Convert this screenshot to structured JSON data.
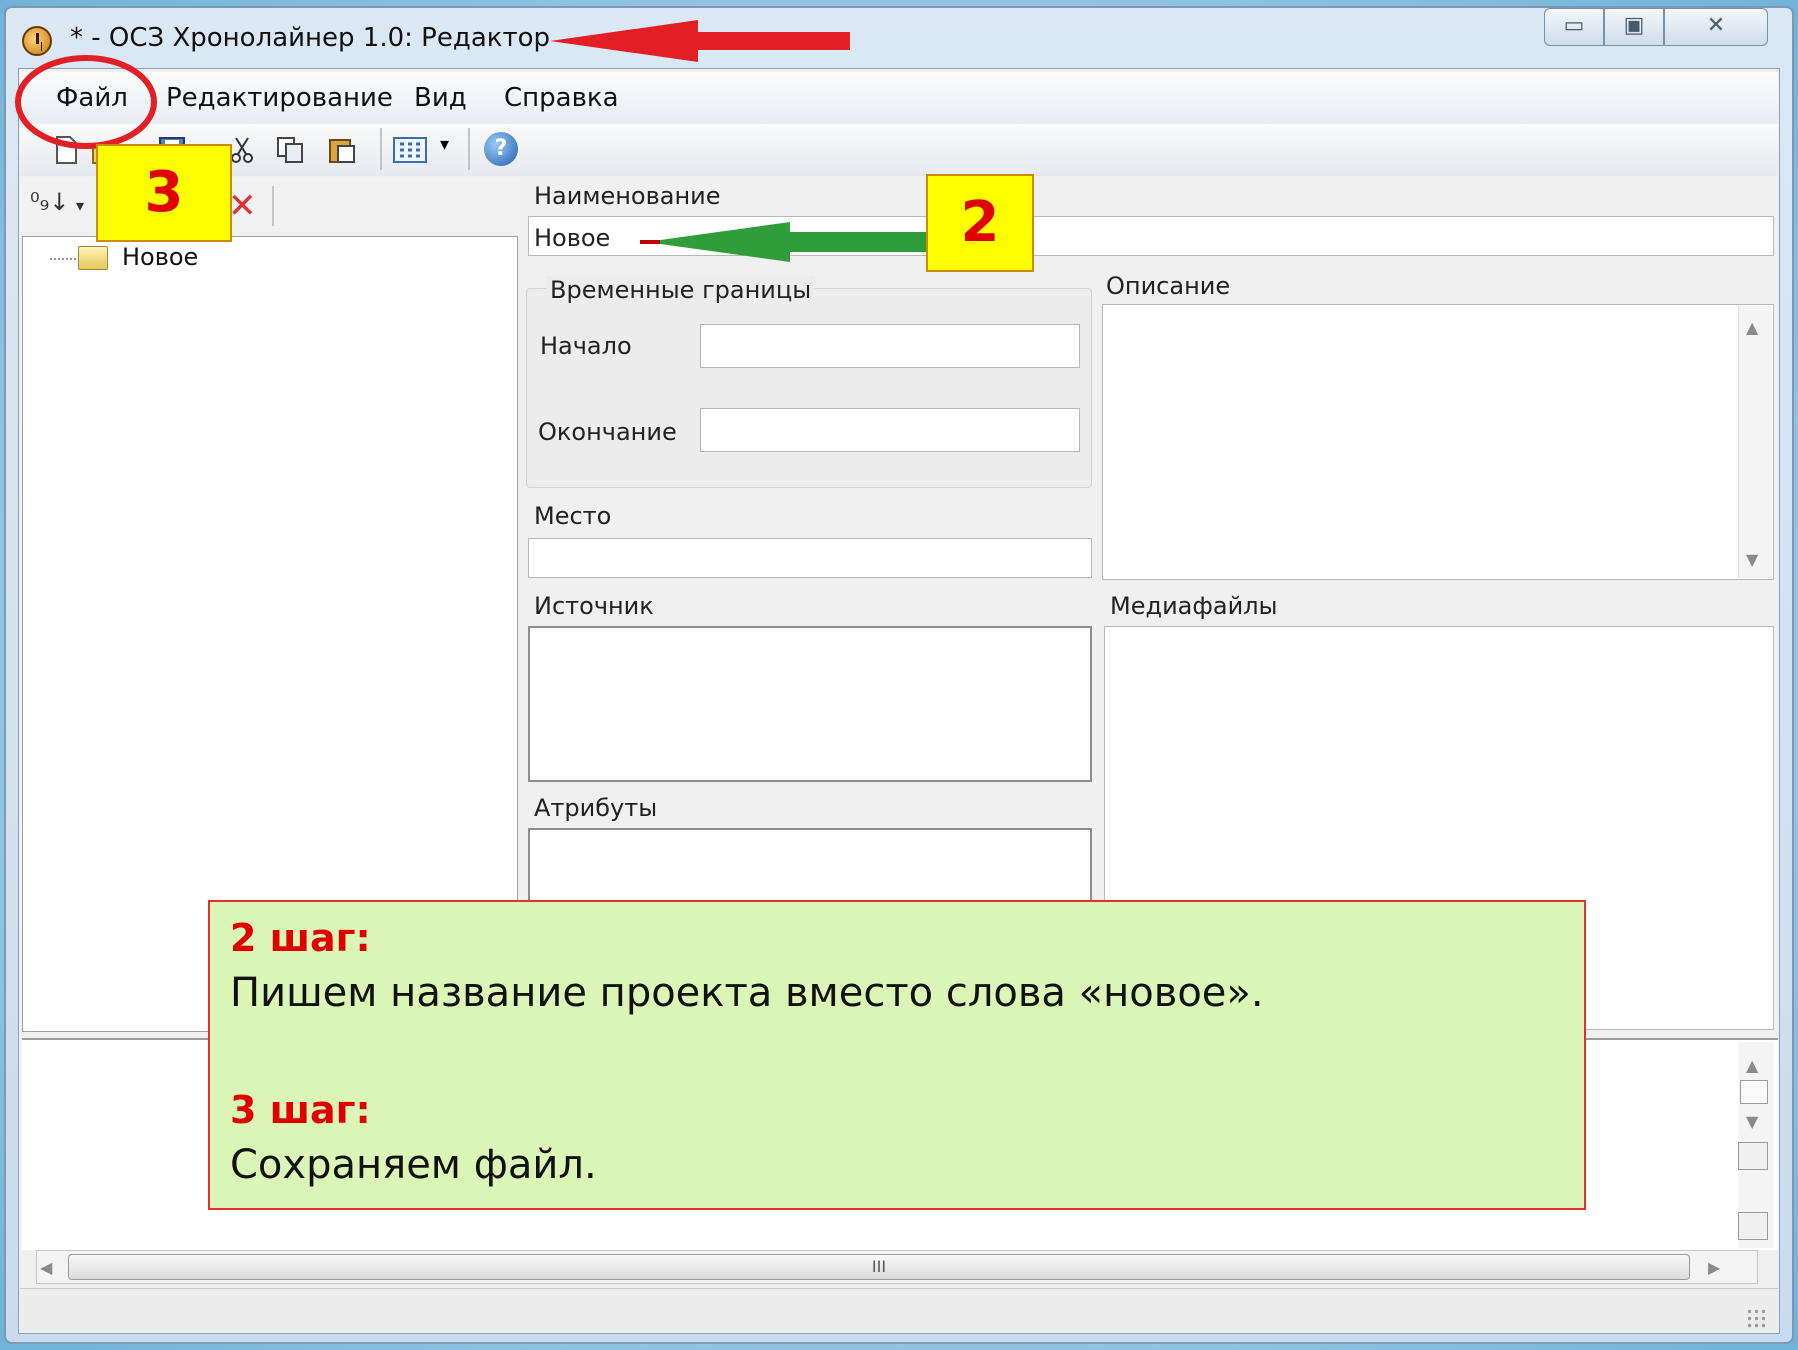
{
  "window": {
    "title": "* - ОСЗ Хронолайнер 1.0: Редактор",
    "min_glyph": "▭",
    "max_glyph": "▣",
    "close_glyph": "✕"
  },
  "menu": {
    "items": [
      "Файл",
      "Редактирование",
      "Вид",
      "Справка"
    ]
  },
  "toolbar": {
    "icons": [
      "new-icon",
      "open-icon",
      "save-icon",
      "cut-icon",
      "copy-icon",
      "paste-icon",
      "view-grid-icon",
      "help-icon"
    ],
    "help_glyph": "?",
    "dropdown_glyph": "▾"
  },
  "left_toolbar": {
    "sort_glyph": "⁰₉↓",
    "delete_glyph": "✕",
    "dropdown_glyph": "▾"
  },
  "tree": {
    "root_label": "Новое"
  },
  "form": {
    "name_label": "Наименование",
    "name_value": "Новое",
    "time_group_label": "Временные границы",
    "start_label": "Начало",
    "start_value": "",
    "end_label": "Окончание",
    "end_value": "",
    "place_label": "Место",
    "place_value": "",
    "description_label": "Описание",
    "source_label": "Источник",
    "media_label": "Медиафайлы",
    "attributes_label": "Атрибуты"
  },
  "scrollbar": {
    "up_glyph": "▲",
    "down_glyph": "▼",
    "left_glyph": "◀",
    "right_glyph": "▶",
    "thumb_grip": "III"
  },
  "annotations": {
    "badge_step2": "2",
    "badge_step3": "3",
    "arrow_red_color": "#e31e24",
    "arrow_green_color": "#2f9e3a",
    "circle_color": "#e31e24",
    "step2_title": "2 шаг:",
    "step2_text": "Пишем название проекта вместо слова «новое».",
    "step3_title": "3 шаг:",
    "step3_text": "Сохраняем файл."
  }
}
